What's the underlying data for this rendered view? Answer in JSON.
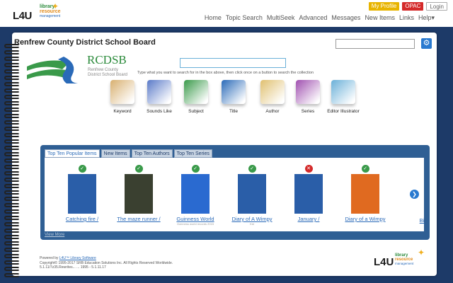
{
  "header": {
    "logo_text": "L4U",
    "logo_lines": [
      "library",
      "resource",
      "management"
    ],
    "buttons": {
      "profile": "My Profile",
      "opac": "OPAC",
      "login": "Login"
    },
    "nav": [
      "Home",
      "Topic Search",
      "MultiSeek",
      "Advanced",
      "Messages",
      "New Items",
      "Links",
      "Help▾"
    ]
  },
  "board": {
    "title": "Renfrew County District School Board",
    "logo_abbr": "RCDSB",
    "logo_sub": [
      "Renfrew County",
      "District School Board"
    ],
    "search_hint": "Type what you want to search for in the box above, then click once on a button to search the collection"
  },
  "search_buttons": [
    {
      "label": "Keyword",
      "icon": "keyword-icon",
      "color": "#d8b070"
    },
    {
      "label": "Sounds Like",
      "icon": "sounds-like-icon",
      "color": "#5a7ac8"
    },
    {
      "label": "Subject",
      "icon": "subject-books-icon",
      "color": "#3a9a4a"
    },
    {
      "label": "Title",
      "icon": "title-book-icon",
      "color": "#2a6ab8"
    },
    {
      "label": "Author",
      "icon": "author-book-icon",
      "color": "#e0c070"
    },
    {
      "label": "Series",
      "icon": "series-books-icon",
      "color": "#a050b0"
    },
    {
      "label": "Editor Illustrator",
      "icon": "editor-illustrator-icon",
      "color": "#6ab0d8"
    }
  ],
  "tabs": [
    "Top Ten Popular Items",
    "New Items",
    "Top Ten Authors",
    "Top Ten Series"
  ],
  "books": [
    {
      "title": "Catching fire /",
      "sub": "",
      "status": "available",
      "cover": "#2a5ea8"
    },
    {
      "title": "The maze runner /",
      "sub": "",
      "status": "available",
      "cover": "#3a4030"
    },
    {
      "title": "Guinness World",
      "sub": "Guinness world records 2015",
      "status": "available",
      "cover": "#2a6ad0"
    },
    {
      "title": "Diary of A Wimpy",
      "sub": "Kid",
      "status": "available",
      "cover": "#2a5ea8"
    },
    {
      "title": "January /",
      "sub": "",
      "status": "unavailable",
      "cover": "#2a5ea8"
    },
    {
      "title": "Diary of a Wimpy",
      "sub": "",
      "status": "available",
      "cover": "#e06a20"
    },
    {
      "title": "Bi",
      "sub": "",
      "status": "",
      "cover": ""
    }
  ],
  "view_more": "View More",
  "footer": {
    "powered_prefix": "Powered by",
    "powered_link": "L4U™ Library Software",
    "copyright": "Copyright© 1995-2017 SRB Education Solutions Inc. All Rights Reserved Worldwide.",
    "version": "5.1.11/7z35.Rewrites... ... 1995 - 5.1.11.17"
  },
  "colors": {
    "page_bg": "#1d3a68",
    "panel": "#2f5f94",
    "accent": "#2a7ad0"
  }
}
